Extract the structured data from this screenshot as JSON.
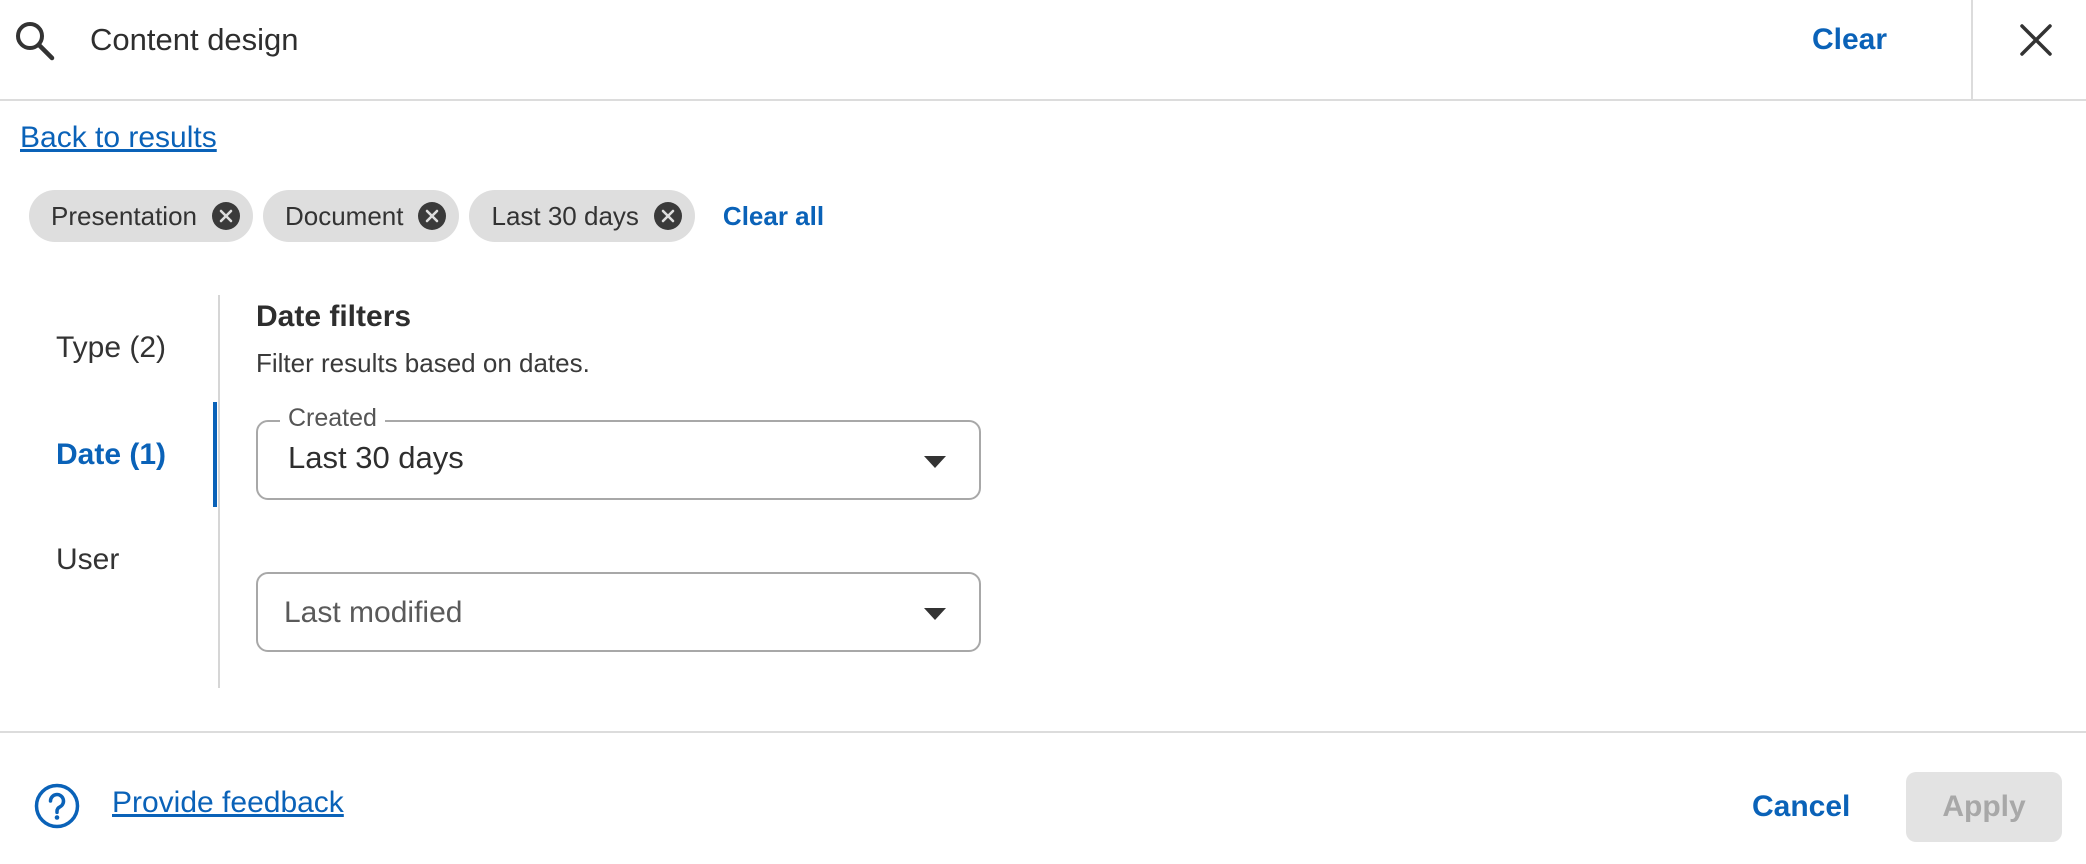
{
  "search": {
    "value": "Content design",
    "clear_label": "Clear",
    "icon": "search-icon",
    "close_icon": "close-icon"
  },
  "back_link": "Back to results",
  "chips": [
    {
      "label": "Presentation"
    },
    {
      "label": "Document"
    },
    {
      "label": "Last 30 days"
    }
  ],
  "clear_all_label": "Clear all",
  "nav": {
    "items": [
      {
        "label": "Type (2)",
        "active": false
      },
      {
        "label": "Date (1)",
        "active": true
      },
      {
        "label": "User",
        "active": false
      }
    ]
  },
  "date_filters": {
    "title": "Date filters",
    "description": "Filter results based on dates.",
    "created": {
      "legend": "Created",
      "value": "Last 30 days"
    },
    "last_modified": {
      "placeholder": "Last modified"
    }
  },
  "footer": {
    "feedback_label": "Provide feedback",
    "cancel_label": "Cancel",
    "apply_label": "Apply"
  },
  "colors": {
    "accent": "#0a62b8",
    "chip_bg": "#dedede",
    "divider": "#dcdcdc",
    "disabled_bg": "#e3e3e3"
  }
}
